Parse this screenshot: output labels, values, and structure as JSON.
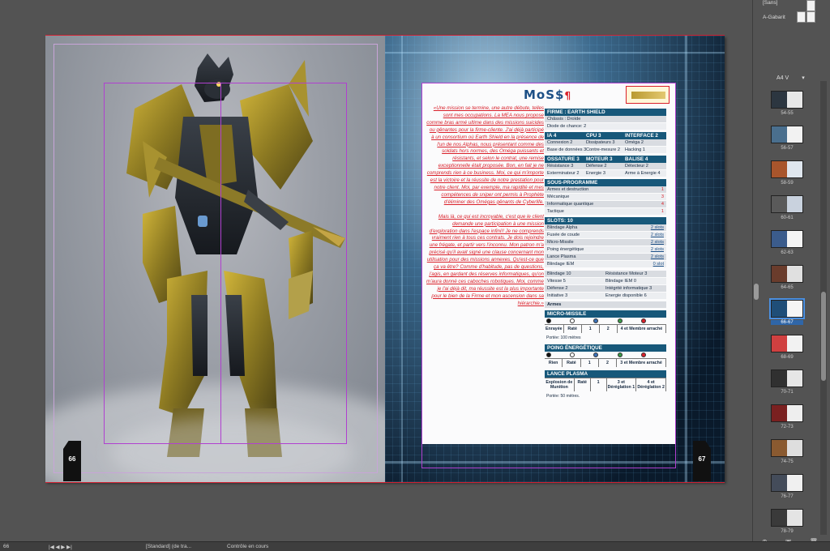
{
  "page_left": {
    "page_number": "66"
  },
  "page_right": {
    "page_number": "67",
    "title": "MoS$",
    "title_mark": "¶",
    "fiction": [
      "«Une mission se termine, une autre débute, telles sont mes occupations. La MEA nous propose comme bras armé ultime dans des missions suicides ou gênantes pour la firme-cliente. J'ai déjà participé à un consortium où Earth Shield en la présence de l'un de nos Alphas, nous présentant comme des soldats hors normes, des Oméga puissants et résistants, et selon le contrat, une remise exceptionnelle était proposée. Bon, en fait je ne comprends rien à ce business. Moi, ce qui m'importe est la victoire et la réussite de notre prestation pour notre client. Moi, par exemple, ma rapidité et mes compétences de sniper ont permis à Prophète d'éliminer des Omégas gênants de Cyberlife.",
      "Mais là, ce qui est incroyable, c'est que le client demande une participation à une mission d'exploration dans l'espace infini!! Je ne comprends vraiment rien à tous ces contrats. Je dois rejoindre une frégate, et partir vers l'inconnu. Mon patron m'a précisé qu'il avait signé une clause concernant mon utilisation pour des missions annexes. Qu'est-ce que ça va être? Comme d'habitude, pas de questions, j'agis, en gardant des réserves informatiques, qu'on m'aura donné ces caboches robotiques. Moi, comme je l'ai déjà dit, ma réussite est la plus importante pour le bien de la Firme et mon ascension dans sa hiérarchie.»"
    ],
    "stats": {
      "firm_header": "FIRME : EARTH SHIELD",
      "chassis_label": "Châssis : Droïde",
      "diode_label": "Diode de chance: 2",
      "ia_header": [
        "IA 4",
        "CPU 3",
        "INTERFACE 2"
      ],
      "ia_rows": [
        [
          "Connexion 2",
          "Dissipateurs 3",
          "Oméga 2"
        ],
        [
          "Base de données 3",
          "Contre-mesure 2",
          "Hacking 1"
        ]
      ],
      "os_header": [
        "OSSATURE 3",
        "MOTEUR 3",
        "BALISE 4"
      ],
      "os_rows": [
        [
          "Résistance 3",
          "Défense 2",
          "Détecteur 2"
        ],
        [
          "Exterminateur 2",
          "Energie 3",
          "Arme à Énergie 4"
        ]
      ],
      "sub_header": "SOUS-PROGRAMME",
      "sub_rows": [
        [
          "Armes et destruction",
          "1"
        ],
        [
          "Mécanique",
          "3"
        ],
        [
          "Informatique quantique",
          "4"
        ],
        [
          "Tactique",
          "1"
        ]
      ],
      "slots_header": "SLOTS: 10",
      "slot_rows": [
        [
          "Blindage Alpha",
          "2 slots"
        ],
        [
          "Fusée de coude",
          "2 slots"
        ],
        [
          "Micro-Missile",
          "2 slots"
        ],
        [
          "Poing énergétique",
          "2 slots"
        ],
        [
          "Lance Plasma",
          "2 slots"
        ],
        [
          "Blindage IEM",
          "0 slot"
        ]
      ],
      "derived_rows": [
        [
          "Blindage 10",
          "Résistance Moteur 3"
        ],
        [
          "Vitesse 5",
          "Blindage IEM 0"
        ],
        [
          "Défense 2",
          "Intégrité informatique 3"
        ],
        [
          "Initiative 3",
          "Energie disponible 6"
        ]
      ],
      "armes_label": "Armes",
      "weapons": [
        {
          "name": "MICRO-MISSILE",
          "cells": [
            "Enrayée",
            "Raté",
            "1",
            "2",
            "4 et Membre arraché"
          ],
          "note": "Portée: 100 mètres"
        },
        {
          "name": "POING ÉNERGÉTIQUE",
          "cells": [
            "Rien",
            "Raté",
            "1",
            "2",
            "3 et Membre arraché"
          ],
          "note": ""
        },
        {
          "name": "LANCE PLASMA",
          "cells": [
            "Explosion de Munition",
            "Raté",
            "1",
            "3 et Déréglation 1",
            "4 et Déréglation 2"
          ],
          "note": "Portée: 50 mètres."
        }
      ]
    }
  },
  "pages_panel": {
    "masters": [
      "[Sans]",
      "A-Gabarit"
    ],
    "preset": "A4 V",
    "spreads": [
      "54-55",
      "56-57",
      "58-59",
      "60-61",
      "62-63",
      "64-65",
      "66-67",
      "68-69",
      "70-71",
      "72-73",
      "74-75",
      "76-77",
      "78-79"
    ],
    "selected": "66-67"
  },
  "status": {
    "zoom": "66",
    "style": "[Standard] (de tra...",
    "info": "Contrôle en cours"
  },
  "colors": {
    "accent_blue": "#17587a",
    "accent_red": "#d9202a",
    "title_blue": "#1c4f86"
  }
}
